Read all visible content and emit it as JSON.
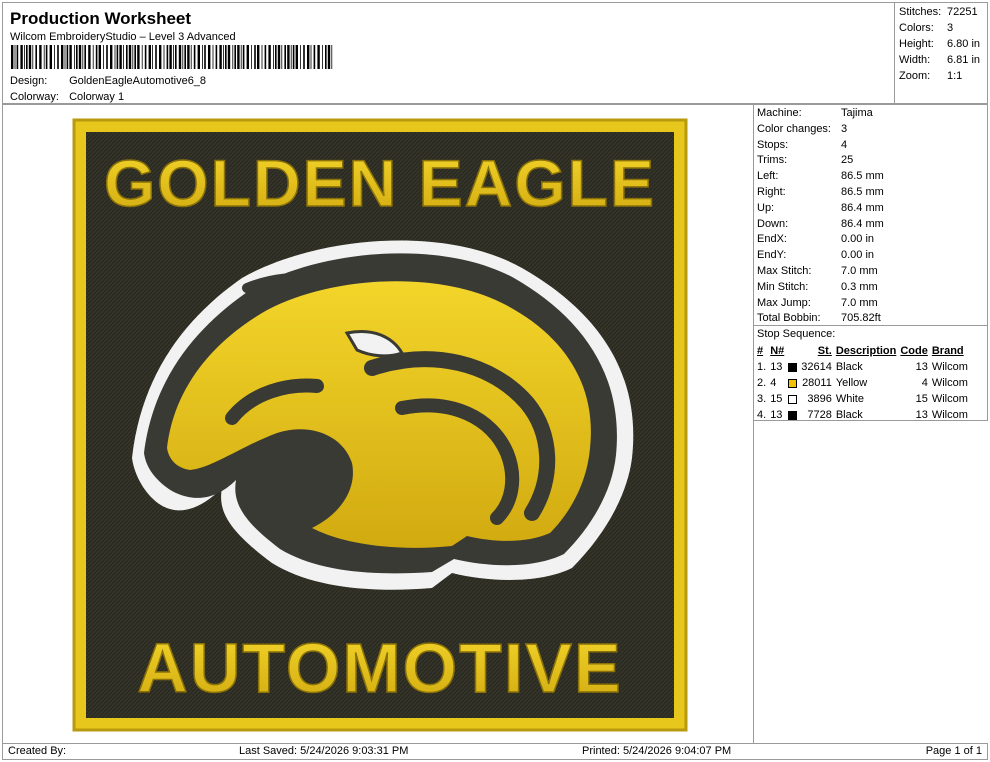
{
  "header": {
    "title": "Production Worksheet",
    "subtitle": "Wilcom EmbroideryStudio – Level 3 Advanced",
    "design_label": "Design:",
    "design_value": "GoldenEagleAutomotive6_8",
    "colorway_label": "Colorway:",
    "colorway_value": "Colorway 1"
  },
  "stats": [
    {
      "label": "Stitches:",
      "value": "72251"
    },
    {
      "label": "Colors:",
      "value": "3"
    },
    {
      "label": "Height:",
      "value": "6.80 in"
    },
    {
      "label": "Width:",
      "value": "6.81 in"
    },
    {
      "label": "Zoom:",
      "value": "1:1"
    }
  ],
  "machine_info": [
    {
      "label": "Machine:",
      "value": "Tajima"
    },
    {
      "label": "Color changes:",
      "value": "3"
    },
    {
      "label": "Stops:",
      "value": "4"
    },
    {
      "label": "Trims:",
      "value": "25"
    },
    {
      "label": "Left:",
      "value": "86.5 mm"
    },
    {
      "label": "Right:",
      "value": "86.5 mm"
    },
    {
      "label": "Up:",
      "value": "86.4 mm"
    },
    {
      "label": "Down:",
      "value": "86.4 mm"
    },
    {
      "label": "EndX:",
      "value": "0.00 in"
    },
    {
      "label": "EndY:",
      "value": "0.00 in"
    },
    {
      "label": "Max Stitch:",
      "value": "7.0 mm"
    },
    {
      "label": "Min Stitch:",
      "value": "0.3 mm"
    },
    {
      "label": "Max Jump:",
      "value": "7.0 mm"
    },
    {
      "label": "Total Bobbin:",
      "value": "705.82ft"
    }
  ],
  "stop_sequence": {
    "caption": "Stop Sequence:",
    "headers": [
      "#",
      "N#",
      "St.",
      "Description",
      "Code",
      "Brand"
    ],
    "rows": [
      {
        "num": "1.",
        "n": "13",
        "color": "#000000",
        "st": "32614",
        "desc": "Black",
        "code": "13",
        "brand": "Wilcom"
      },
      {
        "num": "2.",
        "n": "4",
        "color": "#f2c200",
        "st": "28011",
        "desc": "Yellow",
        "code": "4",
        "brand": "Wilcom"
      },
      {
        "num": "3.",
        "n": "15",
        "color": "#ffffff",
        "st": "3896",
        "desc": "White",
        "code": "15",
        "brand": "Wilcom"
      },
      {
        "num": "4.",
        "n": "13",
        "color": "#000000",
        "st": "7728",
        "desc": "Black",
        "code": "13",
        "brand": "Wilcom"
      }
    ]
  },
  "design": {
    "line1": "GOLDEN EAGLE",
    "line2": "AUTOMOTIVE",
    "colors": {
      "background": "#2c2b22",
      "gold": "#e8c71c",
      "gold_dark": "#b89a0f",
      "white": "#f2f2f2",
      "dark": "#3a3a34"
    }
  },
  "footer": {
    "created": "Created By:",
    "saved": "Last Saved: 5/24/2026 9:03:31 PM",
    "printed": "Printed: 5/24/2026 9:04:07 PM",
    "page": "Page 1 of 1"
  }
}
